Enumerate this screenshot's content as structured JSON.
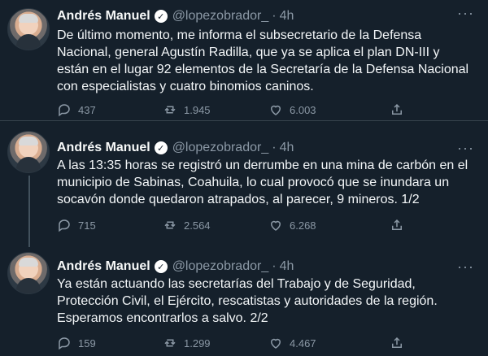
{
  "tweets": [
    {
      "name": "Andrés Manuel",
      "handle": "@lopezobrador_",
      "time": "4h",
      "text": "De último momento, me informa el subsecretario de la Defensa Nacional, general Agustín Radilla, que ya se aplica el plan DN-III y están en el lugar 92 elementos de la Secretaría de la Defensa Nacional con especialistas y cuatro binomios caninos.",
      "replies": "437",
      "retweets": "1.945",
      "likes": "6.003"
    },
    {
      "name": "Andrés Manuel",
      "handle": "@lopezobrador_",
      "time": "4h",
      "text": "A las 13:35 horas se registró un derrumbe en una mina de carbón en el municipio de Sabinas, Coahuila, lo cual provocó que se inundara un socavón donde quedaron atrapados, al parecer, 9 mineros. 1/2",
      "replies": "715",
      "retweets": "2.564",
      "likes": "6.268"
    },
    {
      "name": "Andrés Manuel",
      "handle": "@lopezobrador_",
      "time": "4h",
      "text": "Ya están actuando las secretarías del Trabajo y de Seguridad, Protección Civil, el Ejército, rescatistas y autoridades de la región. Esperamos encontrarlos a salvo. 2/2",
      "replies": "159",
      "retweets": "1.299",
      "likes": "4.467"
    }
  ],
  "ui": {
    "dot": "·",
    "verified_mark": "✓",
    "more_glyph": "···"
  },
  "colors": {
    "background": "#15202b",
    "text": "#f3f6f8",
    "muted": "#8b98a5",
    "divider": "#38444d"
  },
  "icons": [
    "reply-icon",
    "retweet-icon",
    "like-icon",
    "share-icon",
    "more-icon",
    "verified-icon"
  ]
}
